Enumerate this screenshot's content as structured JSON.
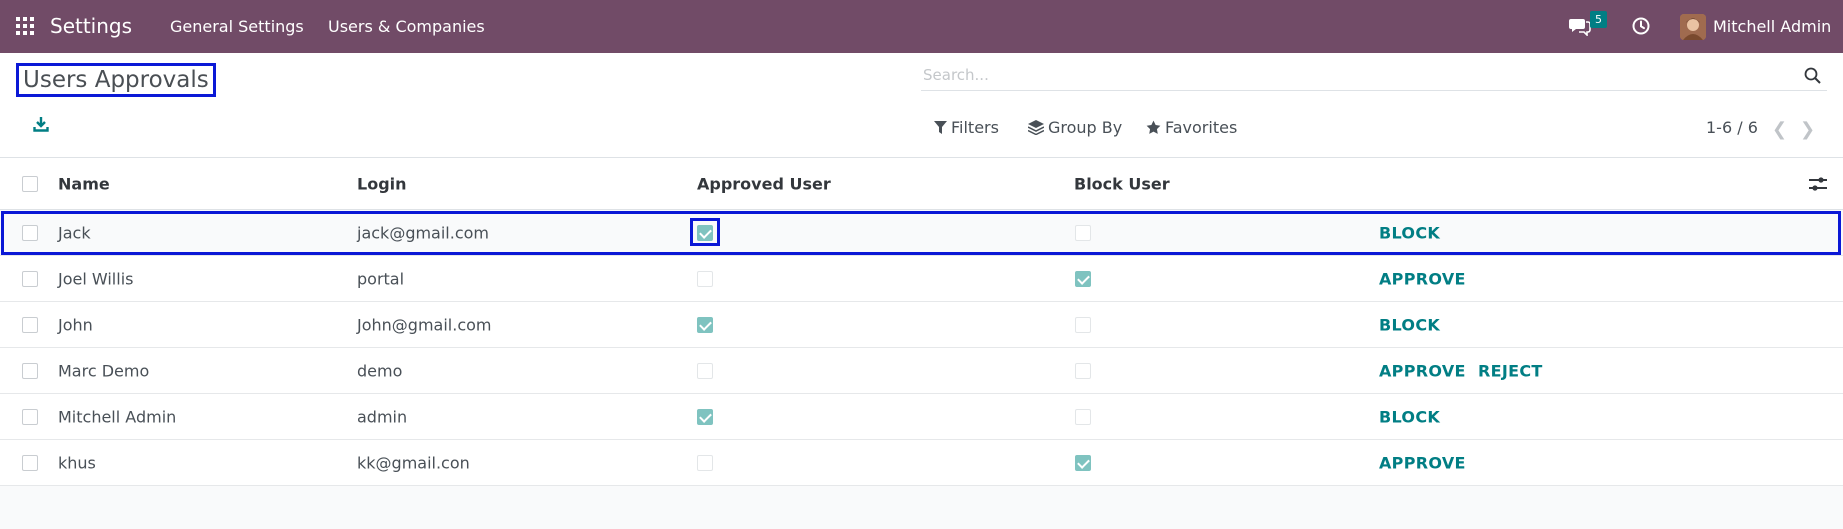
{
  "navbar": {
    "app_name": "Settings",
    "menu": [
      "General Settings",
      "Users & Companies"
    ],
    "messages_badge": "5",
    "user_name": "Mitchell Admin"
  },
  "control_panel": {
    "title": "Users Approvals",
    "search_placeholder": "Search...",
    "filters_label": "Filters",
    "group_by_label": "Group By",
    "favorites_label": "Favorites",
    "pager": "1-6 / 6"
  },
  "table": {
    "columns": [
      "Name",
      "Login",
      "Approved User",
      "Block User"
    ],
    "rows": [
      {
        "name": "Jack",
        "login": "jack@gmail.com",
        "approved": true,
        "blocked": false,
        "actions": [
          "BLOCK"
        ]
      },
      {
        "name": "Joel Willis",
        "login": "portal",
        "approved": false,
        "blocked": true,
        "actions": [
          "APPROVE"
        ]
      },
      {
        "name": "John",
        "login": "John@gmail.com",
        "approved": true,
        "blocked": false,
        "actions": [
          "BLOCK"
        ]
      },
      {
        "name": "Marc Demo",
        "login": "demo",
        "approved": false,
        "blocked": false,
        "actions": [
          "APPROVE",
          "REJECT"
        ]
      },
      {
        "name": "Mitchell Admin",
        "login": "admin",
        "approved": true,
        "blocked": false,
        "actions": [
          "BLOCK"
        ]
      },
      {
        "name": "khus",
        "login": "kk@gmail.con",
        "approved": false,
        "blocked": true,
        "actions": [
          "APPROVE"
        ]
      }
    ]
  },
  "colors": {
    "navbar": "#714b67",
    "accent": "#017e84",
    "highlight": "#0b18d6"
  },
  "icons": [
    "apps-grid-icon",
    "chat-icon",
    "clock-icon",
    "download-icon",
    "search-icon",
    "filter-icon",
    "layers-icon",
    "star-icon",
    "chevron-left-icon",
    "chevron-right-icon",
    "column-settings-icon"
  ]
}
